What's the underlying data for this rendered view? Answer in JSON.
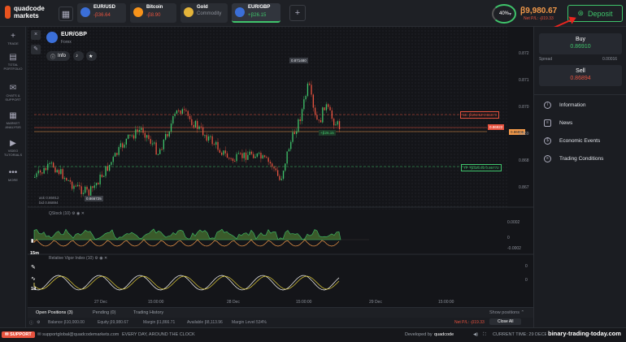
{
  "brand": {
    "line1": "quadcode",
    "line2": "markets",
    "color": "#e8531f"
  },
  "assets": [
    {
      "name": "EUR/USD",
      "change": "-ꞵ36.64",
      "dir": "down",
      "color": "#3b6fd8"
    },
    {
      "name": "Bitcoin",
      "change": "-ꞵ8.90",
      "dir": "down",
      "color": "#f7931a"
    },
    {
      "name": "Gold",
      "change": "Commodity",
      "dir": "neutral",
      "color": "#e4b43a"
    },
    {
      "name": "EUR/GBP",
      "change": "+ꞵ26.15",
      "dir": "up",
      "color": "#3b6fd8"
    }
  ],
  "add_tab": "+",
  "balance": {
    "percent": "40%",
    "value": "ꞵ9,980.67",
    "sub": "Net P/L: -ꞵ19.33"
  },
  "deposit_label": "Deposit",
  "sidebar": [
    {
      "icon": "plus-icon",
      "glyph": "+",
      "label": "TRADE"
    },
    {
      "icon": "portfolio-icon",
      "glyph": "▤",
      "label": "TOTAL PORTFOLIO"
    },
    {
      "icon": "chat-icon",
      "glyph": "✉",
      "label": "CHATS & SUPPORT"
    },
    {
      "icon": "market-analysis-icon",
      "glyph": "▦",
      "label": "MARKET ANALYSIS"
    },
    {
      "icon": "video-icon",
      "glyph": "▶",
      "label": "VIDEO TUTORIALS"
    },
    {
      "icon": "more-icon",
      "glyph": "•••",
      "label": "MORE"
    }
  ],
  "chart_header": {
    "pair": "EUR/GBP",
    "market": "Forex",
    "info_label": "Info"
  },
  "chart_labels": {
    "high": "0.871480",
    "low": "0.866725",
    "ask": "ask 0.86912",
    "bid": "bid 0.86894",
    "sl": "SL -ꞵ104.62 0.86970",
    "current": "0.86922",
    "entry": "0.86906",
    "tp": "TP +ꞵ326.93 0.86772",
    "profit": "+ꞵ26.15"
  },
  "price_axis": [
    "0.872",
    "0.871",
    "0.870",
    "0.869",
    "0.868",
    "0.867"
  ],
  "time_axis": [
    "27 Dec",
    "15:00:00",
    "28 Dec",
    "15:00:00",
    "29 Dec",
    "15:00:00"
  ],
  "indicators": [
    {
      "name": "QStock (10)",
      "axis": [
        "0.0002",
        "0",
        "-0.0002"
      ]
    },
    {
      "name": "Relative Vigor Index (10)",
      "axis": [
        "0",
        "0"
      ]
    }
  ],
  "timeframes": [
    "15m",
    "1d"
  ],
  "right_panel": {
    "buy_label": "Buy",
    "buy_price": "0.86910",
    "spread_label": "Spread",
    "spread_value": "0.00016",
    "sell_label": "Sell",
    "sell_price": "0.86894",
    "menu": [
      {
        "icon": "info-icon",
        "glyph": "i",
        "label": "Information"
      },
      {
        "icon": "news-icon",
        "glyph": "≡",
        "label": "News"
      },
      {
        "icon": "calendar-icon",
        "glyph": "$",
        "label": "Economic Events"
      },
      {
        "icon": "conditions-icon",
        "glyph": "≡",
        "label": "Trading Conditions"
      }
    ]
  },
  "bottom_tabs": [
    "Open Positions (3)",
    "Pending (0)",
    "Trading History"
  ],
  "show_positions": "Show positions",
  "footer": {
    "balance": "Balance ꞵ10,000.00",
    "equity": "Equity ꞵ9,980.67",
    "margin": "Margin ꞵ1,866.71",
    "available": "Available ꞵ8,113.96",
    "margin_level": "Margin Level 534%",
    "net_pl": "Net P/L: -ꞵ19.33",
    "close_all": "Close All"
  },
  "status": {
    "support": "SUPPORT",
    "email": "supportglobal@quadcodemarkets.com",
    "slogan": "EVERY DAY, AROUND THE CLOCK",
    "developed": "Developed by",
    "developer": "quadcode",
    "current_time": "CURRENT TIME: 29 DECEMBER, 01:02:31 (UTC+3)"
  },
  "watermark": "binary-trading-today.com",
  "colors": {
    "up": "#3fc46b",
    "down": "#e8533f",
    "orange": "#f2994a"
  }
}
